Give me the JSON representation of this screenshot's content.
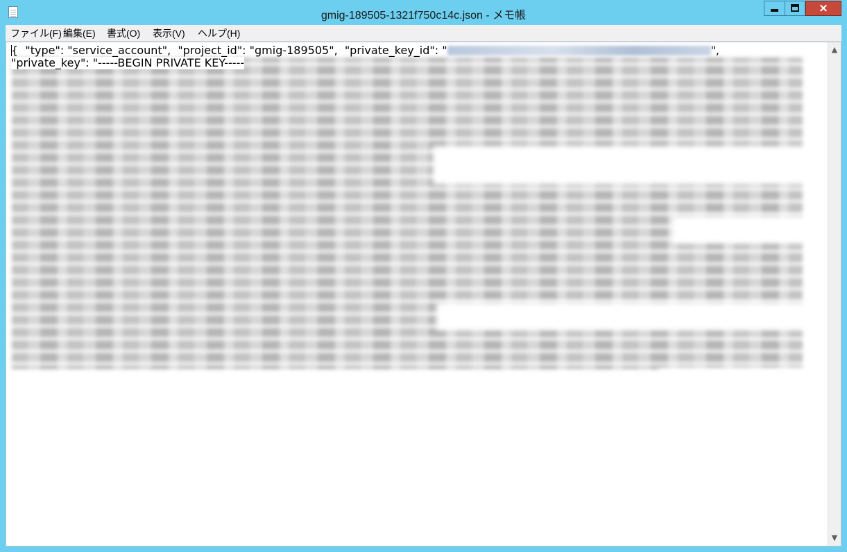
{
  "window": {
    "title": "gmig-189505-1321f750c14c.json - メモ帳",
    "close_glyph": "×"
  },
  "menu": {
    "items": [
      "ファイル(F)",
      "編集(E)",
      "書式(O)",
      "表示(V)",
      "ヘルプ(H)"
    ]
  },
  "editor": {
    "line1_text": "{  \"type\": \"service_account\",  \"project_id\": \"gmig-189505\",  \"private_key_id\": \"",
    "line1_suffix": "\",",
    "line2_text": "\"private_key\": \"-----BEGIN PRIVATE KEY-----"
  },
  "scrollbar": {
    "up_glyph": "▲",
    "down_glyph": "▼"
  }
}
